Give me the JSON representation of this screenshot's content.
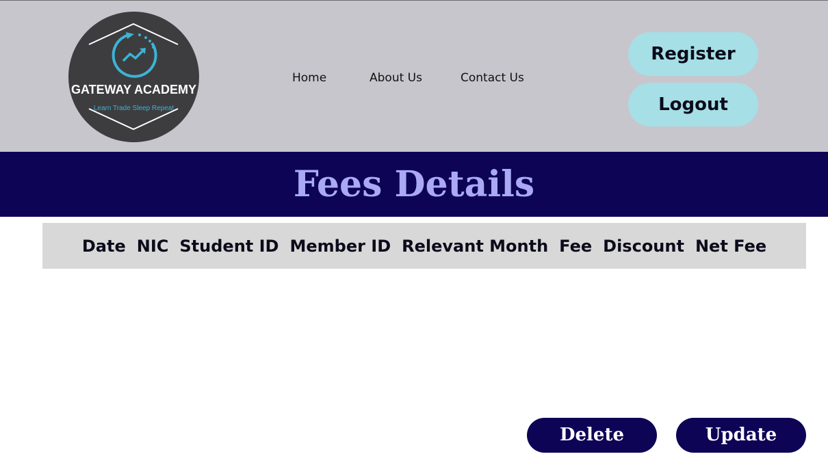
{
  "brand": {
    "name": "GATEWAY ACADEMY",
    "tagline": "Learn Trade Sleep Repeat",
    "colors": {
      "logo_bg": "#3d3d3f",
      "logo_accent": "#3bb4d6"
    }
  },
  "nav": {
    "items": [
      {
        "label": "Home"
      },
      {
        "label": "About Us"
      },
      {
        "label": "Contact Us"
      }
    ]
  },
  "auth": {
    "register_label": "Register",
    "logout_label": "Logout"
  },
  "page": {
    "title": "Fees Details"
  },
  "table": {
    "columns": [
      "Date",
      "NIC",
      "Student ID",
      "Member ID",
      "Relevant Month",
      "Fee",
      "Discount",
      "Net Fee"
    ],
    "rows": []
  },
  "actions": {
    "delete_label": "Delete",
    "update_label": "Update"
  },
  "colors": {
    "header_bg": "#c7c6cc",
    "banner_bg": "#0d0456",
    "title_color": "#a9a9f5",
    "pill_bg": "#a6dfe6",
    "table_header_bg": "#d8d8d8",
    "action_bg": "#0d0456"
  }
}
